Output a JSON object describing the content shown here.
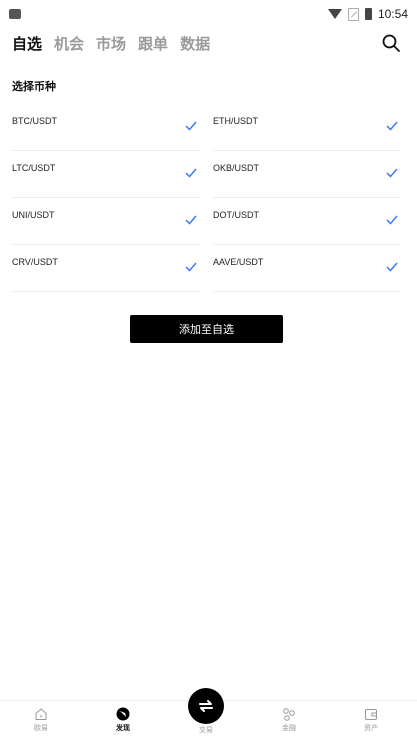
{
  "status_bar": {
    "time": "10:54"
  },
  "tabs": [
    {
      "label": "自选",
      "active": true
    },
    {
      "label": "机会",
      "active": false
    },
    {
      "label": "市场",
      "active": false
    },
    {
      "label": "跟单",
      "active": false
    },
    {
      "label": "数据",
      "active": false
    }
  ],
  "section_title": "选择币种",
  "coins": [
    {
      "name": "BTC/USDT",
      "checked": true
    },
    {
      "name": "ETH/USDT",
      "checked": true
    },
    {
      "name": "LTC/USDT",
      "checked": true
    },
    {
      "name": "OKB/USDT",
      "checked": true
    },
    {
      "name": "UNI/USDT",
      "checked": true
    },
    {
      "name": "DOT/USDT",
      "checked": true
    },
    {
      "name": "CRV/USDT",
      "checked": true
    },
    {
      "name": "AAVE/USDT",
      "checked": true
    }
  ],
  "add_button_label": "添加至自选",
  "bottom_nav": {
    "items": [
      {
        "label": "欧易"
      },
      {
        "label": "发现"
      },
      {
        "label": "交易"
      },
      {
        "label": "金融"
      },
      {
        "label": "资产"
      }
    ]
  },
  "colors": {
    "accent": "#3d7bf2",
    "primary": "#000000"
  }
}
